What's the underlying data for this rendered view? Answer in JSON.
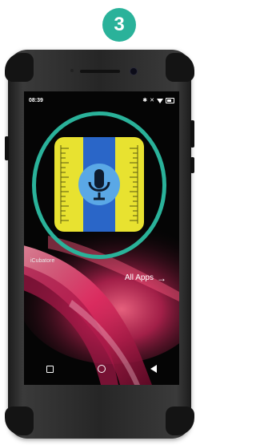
{
  "step": {
    "number": "3"
  },
  "status_bar": {
    "time": "08:39",
    "icons": [
      "bluetooth-icon",
      "mute-icon",
      "wifi-icon",
      "battery-icon"
    ]
  },
  "home": {
    "app_label": "iCubatore",
    "all_apps_label": "All Apps",
    "all_apps_icon": "arrow-right-icon"
  },
  "nav_bar": {
    "buttons": [
      "recents-square-icon",
      "home-circle-icon",
      "back-triangle-icon"
    ]
  },
  "app_icon": {
    "name": "microphone-ruler-app-icon",
    "icon": "microphone-icon"
  },
  "colors": {
    "accent": "#2ab29a",
    "icon_yellow": "#e8e230",
    "icon_blue": "#2a66c8",
    "icon_light_blue": "#5aa8e6",
    "wallpaper_pink": "#d6285e"
  }
}
